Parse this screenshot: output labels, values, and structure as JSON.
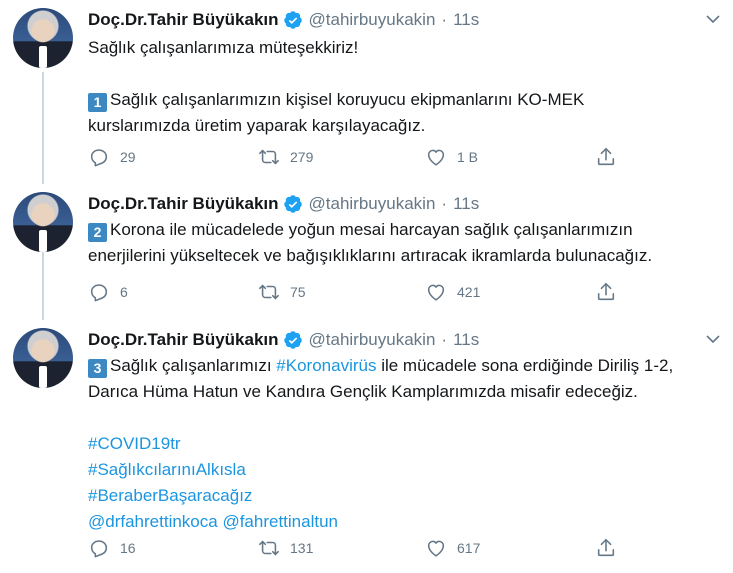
{
  "tweets": [
    {
      "name": "Doç.Dr.Tahir Büyükakın",
      "handle": "@tahirbuyukakin",
      "time": "11s",
      "line1": "Sağlık çalışanlarımıza müteşekkiriz!",
      "badge": "1",
      "line2": "Sağlık çalışanlarımızın kişisel koruyucu ekipmanlarını KO-MEK",
      "line3": "kurslarımızda üretim yaparak karşılayacağız.",
      "replies": "29",
      "retweets": "279",
      "likes": "1 B"
    },
    {
      "name": "Doç.Dr.Tahir Büyükakın",
      "handle": "@tahirbuyukakin",
      "time": "11s",
      "badge": "2",
      "line1": "Korona ile mücadelede yoğun mesai harcayan sağlık çalışanlarımızın",
      "line2": "enerjilerini yükseltecek ve bağışıklıklarını artıracak ikramlarda bulunacağız.",
      "replies": "6",
      "retweets": "75",
      "likes": "421"
    },
    {
      "name": "Doç.Dr.Tahir Büyükakın",
      "handle": "@tahirbuyukakin",
      "time": "11s",
      "badge": "3",
      "line1_pre": "Sağlık çalışanlarımızı",
      "line1_tag": "#Koronavirüs",
      "line1_post": "ile mücadele sona erdiğinde Diriliş 1-2,",
      "line2": "Darıca Hüma Hatun ve Kandıra Gençlik Kamplarımızda misafir edeceğiz.",
      "tags": [
        "#COVID19tr",
        "#SağlıkcılarınıAlkısla",
        "#BeraberBaşaracağız"
      ],
      "mention1": "@drfahrettinkoca",
      "mention2": "@fahrettinaltun",
      "replies": "16",
      "retweets": "131",
      "likes": "617"
    }
  ],
  "colors": {
    "link": "#1b95e0",
    "verified": "#1da1f2",
    "muted": "#657786",
    "badge": "#3b88c3"
  },
  "icons": [
    "verified-badge-icon",
    "chevron-down-icon",
    "reply-icon",
    "retweet-icon",
    "like-icon",
    "share-icon"
  ]
}
